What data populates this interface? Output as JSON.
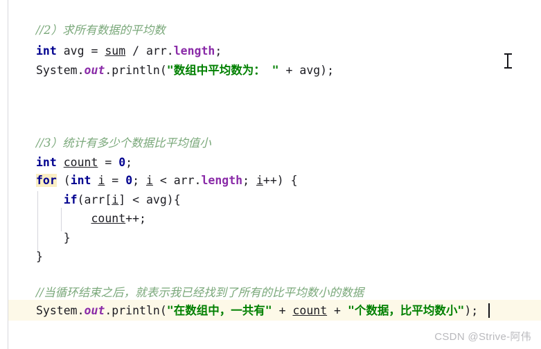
{
  "editor": {
    "background_color": "#ffffff",
    "current_line_highlight_color": "#fdf9e8",
    "keyword_highlight_color": "#faeec3",
    "gutter_rule_color": "#d8d8dc",
    "indent_guide_color": "#d5d5dc",
    "colors": {
      "keyword": "#00008f",
      "field": "#8a2ba8",
      "member": "#8a2ba8",
      "string": "#008000",
      "comment": "#7aa87a",
      "plain_text": "#1c1c22",
      "caret": "#101014"
    },
    "lines": [
      {
        "id": "line-comment-2",
        "kind": "comment",
        "tokens": [
          {
            "t": "//2）求所有数据的平均数",
            "c": "comment"
          }
        ]
      },
      {
        "id": "line-int-avg",
        "kind": "code",
        "tokens": [
          {
            "t": "int",
            "c": "kw"
          },
          {
            "t": " avg = ",
            "c": "plain"
          },
          {
            "t": "sum",
            "c": "var-u"
          },
          {
            "t": " / arr.",
            "c": "plain"
          },
          {
            "t": "length",
            "c": "member"
          },
          {
            "t": ";",
            "c": "plain"
          }
        ]
      },
      {
        "id": "line-print-avg",
        "kind": "code",
        "tokens": [
          {
            "t": "System.",
            "c": "plain"
          },
          {
            "t": "out",
            "c": "field"
          },
          {
            "t": ".println(",
            "c": "plain"
          },
          {
            "t": "\"",
            "c": "str"
          },
          {
            "t": "数组中平均数为：",
            "c": "str-cjk"
          },
          {
            "t": " \"",
            "c": "str"
          },
          {
            "t": " + avg);",
            "c": "plain"
          }
        ]
      },
      {
        "id": "line-comment-3",
        "kind": "comment",
        "tokens": [
          {
            "t": "//3）统计有多少个数据比平均值小",
            "c": "comment"
          }
        ]
      },
      {
        "id": "line-int-count",
        "kind": "code",
        "tokens": [
          {
            "t": "int",
            "c": "kw"
          },
          {
            "t": " ",
            "c": "plain"
          },
          {
            "t": "count",
            "c": "var-u"
          },
          {
            "t": " = ",
            "c": "plain"
          },
          {
            "t": "0",
            "c": "num"
          },
          {
            "t": ";",
            "c": "plain"
          }
        ]
      },
      {
        "id": "line-for",
        "kind": "code",
        "tokens": [
          {
            "t": "for",
            "c": "kw-hl"
          },
          {
            "t": " (",
            "c": "plain"
          },
          {
            "t": "int",
            "c": "kw"
          },
          {
            "t": " ",
            "c": "plain"
          },
          {
            "t": "i",
            "c": "var-u"
          },
          {
            "t": " = ",
            "c": "plain"
          },
          {
            "t": "0",
            "c": "num"
          },
          {
            "t": "; ",
            "c": "plain"
          },
          {
            "t": "i",
            "c": "var-u"
          },
          {
            "t": " < arr.",
            "c": "plain"
          },
          {
            "t": "length",
            "c": "member"
          },
          {
            "t": "; ",
            "c": "plain"
          },
          {
            "t": "i",
            "c": "var-u"
          },
          {
            "t": "++) {",
            "c": "plain"
          }
        ]
      },
      {
        "id": "line-if",
        "kind": "code",
        "tokens": [
          {
            "t": "    ",
            "c": "plain"
          },
          {
            "t": "if",
            "c": "kw"
          },
          {
            "t": "(arr[",
            "c": "plain"
          },
          {
            "t": "i",
            "c": "var-u"
          },
          {
            "t": "] < avg){",
            "c": "plain"
          }
        ]
      },
      {
        "id": "line-count-inc",
        "kind": "code",
        "tokens": [
          {
            "t": "        ",
            "c": "plain"
          },
          {
            "t": "count",
            "c": "var-u"
          },
          {
            "t": "++;",
            "c": "plain"
          }
        ]
      },
      {
        "id": "line-close-if",
        "kind": "code",
        "tokens": [
          {
            "t": "    }",
            "c": "plain"
          }
        ]
      },
      {
        "id": "line-close-for",
        "kind": "code",
        "tokens": [
          {
            "t": "}",
            "c": "plain"
          }
        ]
      },
      {
        "id": "line-comment-loop-end",
        "kind": "comment",
        "tokens": [
          {
            "t": "//当循环结束之后，就表示我已经找到了所有的比平均数小的数据",
            "c": "comment"
          }
        ]
      },
      {
        "id": "line-print-result",
        "kind": "code",
        "highlighted": true,
        "tokens": [
          {
            "t": "System.",
            "c": "plain"
          },
          {
            "t": "out",
            "c": "field"
          },
          {
            "t": ".println(",
            "c": "plain"
          },
          {
            "t": "\"",
            "c": "str"
          },
          {
            "t": "在数组中，一共有",
            "c": "str-cjk"
          },
          {
            "t": "\"",
            "c": "str"
          },
          {
            "t": " + ",
            "c": "plain"
          },
          {
            "t": "count",
            "c": "var-u"
          },
          {
            "t": " + ",
            "c": "plain"
          },
          {
            "t": "\"",
            "c": "str"
          },
          {
            "t": "个数据，比平均数小",
            "c": "str-cjk"
          },
          {
            "t": "\"",
            "c": "str"
          },
          {
            "t": ");",
            "c": "plain"
          }
        ]
      }
    ]
  },
  "caret": {
    "name": "text-caret",
    "visible": true
  },
  "mouse_pointer": {
    "name": "i-beam-pointer",
    "visible": true
  },
  "watermark": {
    "text": "CSDN @Strive-阿伟",
    "color": "#b9b9bd"
  }
}
